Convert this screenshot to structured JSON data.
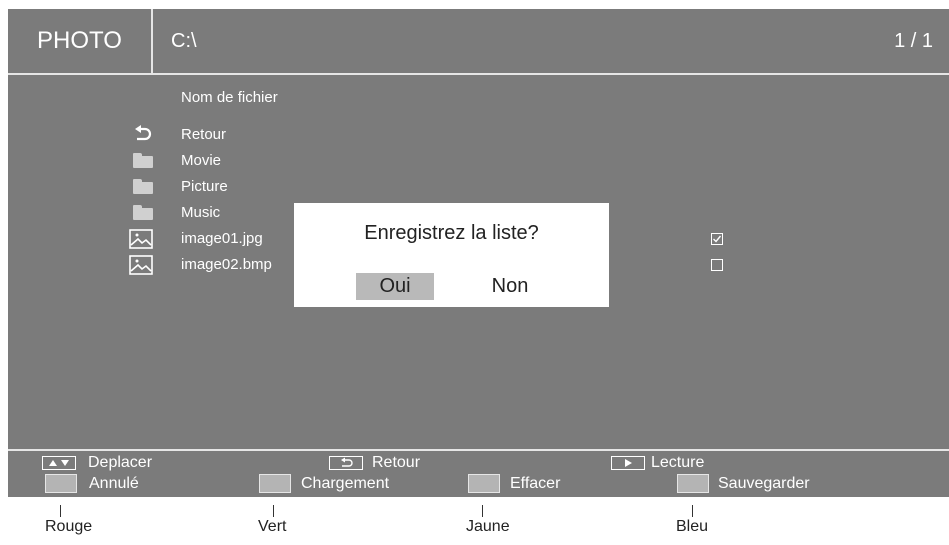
{
  "header": {
    "mode": "PHOTO",
    "path": "C:\\",
    "page": "1 / 1"
  },
  "list": {
    "column_header": "Nom de fichier",
    "items": [
      {
        "icon": "return-icon",
        "name": "Retour"
      },
      {
        "icon": "folder-icon",
        "name": "Movie"
      },
      {
        "icon": "folder-icon",
        "name": "Picture"
      },
      {
        "icon": "folder-icon",
        "name": "Music"
      },
      {
        "icon": "image-file-icon",
        "name": "image01.jpg",
        "checked": true
      },
      {
        "icon": "image-file-icon",
        "name": "image02.bmp",
        "checked": false
      }
    ]
  },
  "dialog": {
    "question": "Enregistrez la liste?",
    "yes": "Oui",
    "no": "Non",
    "selected": "Oui"
  },
  "footer": {
    "navigate": "Deplacer",
    "back": "Retour",
    "play": "Lecture",
    "red": "Annulé",
    "green": "Chargement",
    "yellow": "Effacer",
    "blue": "Sauvegarder"
  },
  "callouts": {
    "red": "Rouge",
    "green": "Vert",
    "yellow": "Jaune",
    "blue": "Bleu"
  },
  "colors": {
    "background": "#7b7b7b",
    "dialog": "#ffffff",
    "selected_button": "#b9b9b9",
    "swatch": "#b4b4b4"
  }
}
